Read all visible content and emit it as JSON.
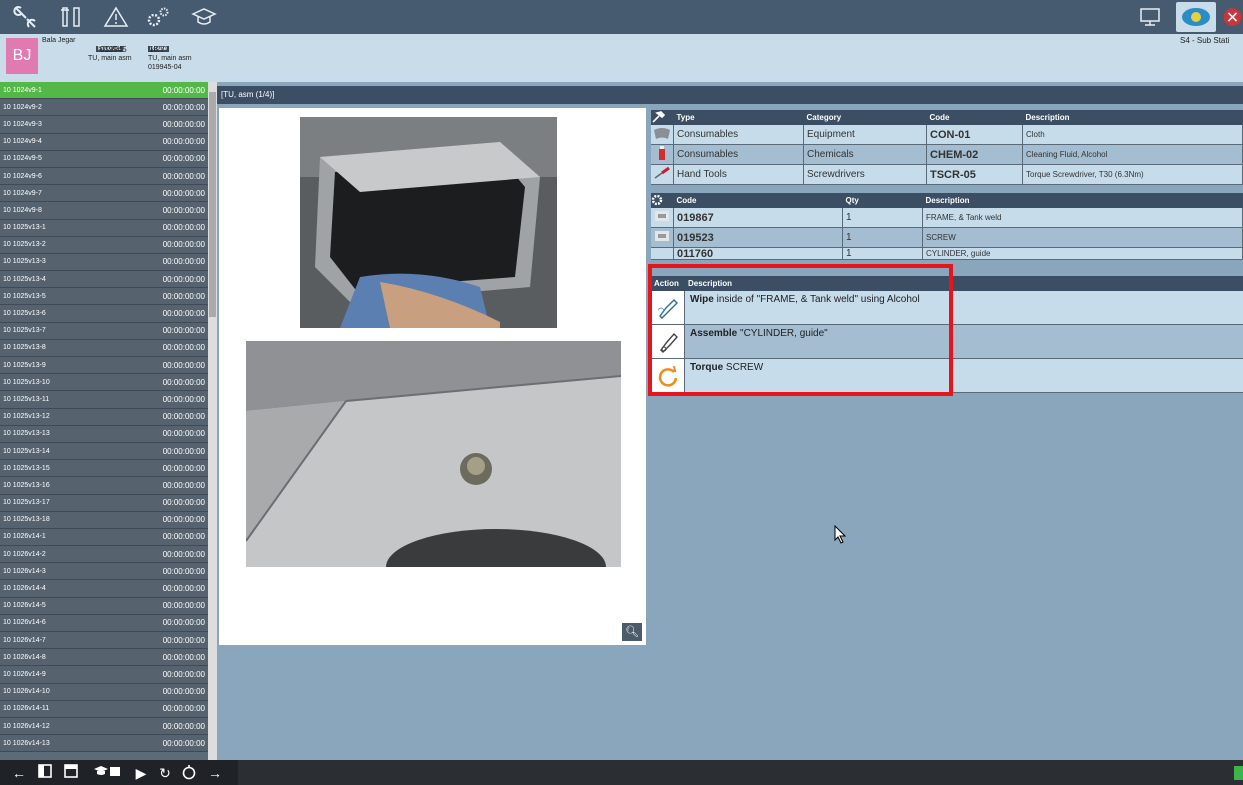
{
  "toolbar": {
    "icons": [
      "tools-icon",
      "wrench-screwdriver-icon",
      "warning-icon",
      "gears-icon",
      "graduation-cap-icon"
    ],
    "right_icons": [
      "monitor-icon",
      "camera-eye-icon",
      "close-icon"
    ]
  },
  "info": {
    "avatar_initials": "BJ",
    "user_name": "Bala Jegar",
    "product_tag": "Product",
    "product_code": "019945",
    "product_desc": "TU, main asm",
    "route_tag": "Route",
    "route_code": "18.7",
    "route_desc": "TU, main asm",
    "route_sub": "019945-04",
    "station": "S4 - Sub Stati"
  },
  "steps": [
    {
      "id": "10 1024v9-1",
      "time": "00:00:00:00"
    },
    {
      "id": "10 1024v9-2",
      "time": "00:00:00:00"
    },
    {
      "id": "10 1024v9-3",
      "time": "00:00:00:00"
    },
    {
      "id": "10 1024v9-4",
      "time": "00:00:00:00"
    },
    {
      "id": "10 1024v9-5",
      "time": "00:00:00:00"
    },
    {
      "id": "10 1024v9-6",
      "time": "00:00:00:00"
    },
    {
      "id": "10 1024v9-7",
      "time": "00:00:00:00"
    },
    {
      "id": "10 1024v9-8",
      "time": "00:00:00:00"
    },
    {
      "id": "10 1025v13-1",
      "time": "00:00:00:00"
    },
    {
      "id": "10 1025v13-2",
      "time": "00:00:00:00"
    },
    {
      "id": "10 1025v13-3",
      "time": "00:00:00:00"
    },
    {
      "id": "10 1025v13-4",
      "time": "00:00:00:00"
    },
    {
      "id": "10 1025v13-5",
      "time": "00:00:00:00"
    },
    {
      "id": "10 1025v13-6",
      "time": "00:00:00:00"
    },
    {
      "id": "10 1025v13-7",
      "time": "00:00:00:00"
    },
    {
      "id": "10 1025v13-8",
      "time": "00:00:00:00"
    },
    {
      "id": "10 1025v13-9",
      "time": "00:00:00:00"
    },
    {
      "id": "10 1025v13-10",
      "time": "00:00:00:00"
    },
    {
      "id": "10 1025v13-11",
      "time": "00:00:00:00"
    },
    {
      "id": "10 1025v13-12",
      "time": "00:00:00:00"
    },
    {
      "id": "10 1025v13-13",
      "time": "00:00:00:00"
    },
    {
      "id": "10 1025v13-14",
      "time": "00:00:00:00"
    },
    {
      "id": "10 1025v13-15",
      "time": "00:00:00:00"
    },
    {
      "id": "10 1025v13-16",
      "time": "00:00:00:00"
    },
    {
      "id": "10 1025v13-17",
      "time": "00:00:00:00"
    },
    {
      "id": "10 1025v13-18",
      "time": "00:00:00:00"
    },
    {
      "id": "10 1026v14-1",
      "time": "00:00:00:00"
    },
    {
      "id": "10 1026v14-2",
      "time": "00:00:00:00"
    },
    {
      "id": "10 1026v14-3",
      "time": "00:00:00:00"
    },
    {
      "id": "10 1026v14-4",
      "time": "00:00:00:00"
    },
    {
      "id": "10 1026v14-5",
      "time": "00:00:00:00"
    },
    {
      "id": "10 1026v14-6",
      "time": "00:00:00:00"
    },
    {
      "id": "10 1026v14-7",
      "time": "00:00:00:00"
    },
    {
      "id": "10 1026v14-8",
      "time": "00:00:00:00"
    },
    {
      "id": "10 1026v14-9",
      "time": "00:00:00:00"
    },
    {
      "id": "10 1026v14-10",
      "time": "00:00:00:00"
    },
    {
      "id": "10 1026v14-11",
      "time": "00:00:00:00"
    },
    {
      "id": "10 1026v14-12",
      "time": "00:00:00:00"
    },
    {
      "id": "10 1026v14-13",
      "time": "00:00:00:00"
    }
  ],
  "main": {
    "header": "[TU, asm (1/4)]"
  },
  "tools_table": {
    "headers": [
      "Type",
      "Category",
      "Code",
      "Description"
    ],
    "rows": [
      {
        "icon": "cloth-icon",
        "type": "Consumables",
        "category": "Equipment",
        "code": "CON-01",
        "description": "Cloth"
      },
      {
        "icon": "bottle-icon",
        "type": "Consumables",
        "category": "Chemicals",
        "code": "CHEM-02",
        "description": "Cleaning Fluid, Alcohol"
      },
      {
        "icon": "screwdriver-icon",
        "type": "Hand Tools",
        "category": "Screwdrivers",
        "code": "TSCR-05",
        "description": "Torque Screwdriver, T30 (6.3Nm)"
      }
    ]
  },
  "parts_table": {
    "headers": [
      "Code",
      "Qty",
      "Description"
    ],
    "rows": [
      {
        "code": "019867",
        "qty": "1",
        "description": "FRAME, & Tank weld"
      },
      {
        "code": "019523",
        "qty": "1",
        "description": "SCREW"
      },
      {
        "code": "011760",
        "qty": "1",
        "description": "CYLINDER, guide"
      }
    ]
  },
  "actions": {
    "headers": [
      "Action",
      "Description"
    ],
    "rows": [
      {
        "icon": "wipe-hand-icon",
        "verb": "Wipe",
        "text": " inside of \"FRAME, & Tank weld\" using Alcohol"
      },
      {
        "icon": "assemble-hand-icon",
        "verb": "Assemble",
        "text": " \"CYLINDER, guide\""
      },
      {
        "icon": "torque-rotate-icon",
        "verb": "Torque",
        "text": " SCREW"
      }
    ]
  },
  "bottom_icons": [
    "back-arrow-icon",
    "panel-left-icon",
    "panel-top-icon",
    "training-icon",
    "play-icon",
    "refresh-icon",
    "timer-icon",
    "forward-arrow-icon"
  ]
}
